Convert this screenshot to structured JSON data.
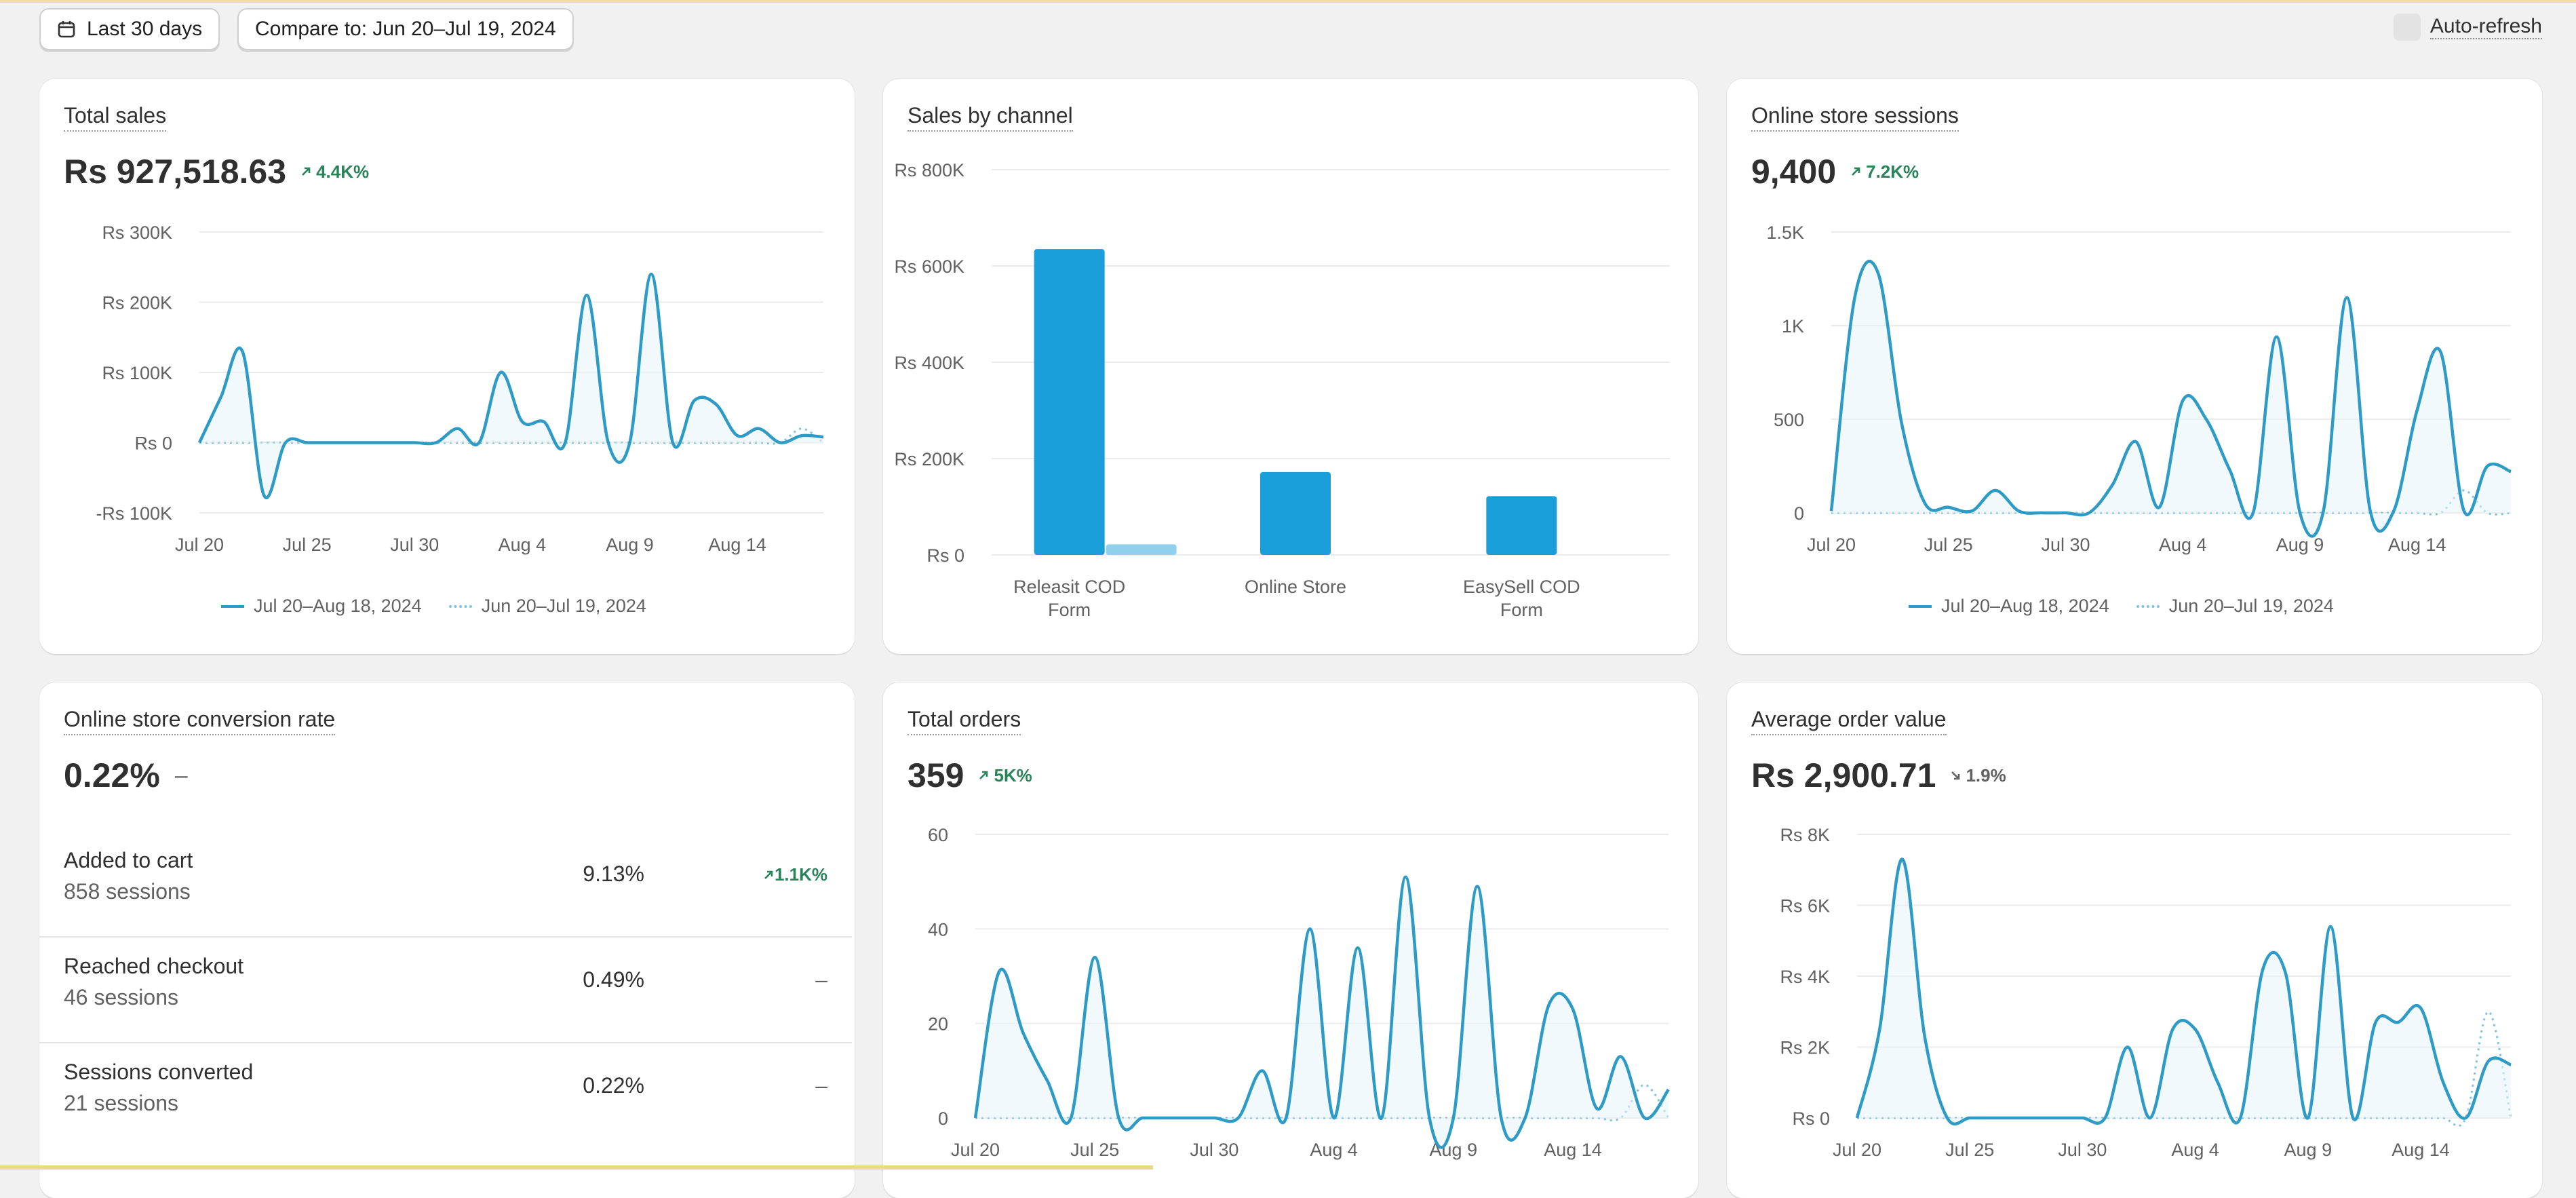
{
  "toolbar": {
    "date_range_label": "Last 30 days",
    "compare_label": "Compare to: Jun 20–Jul 19, 2024",
    "auto_refresh_label": "Auto-refresh"
  },
  "legend": {
    "current": "Jul 20–Aug 18, 2024",
    "previous": "Jun 20–Jul 19, 2024"
  },
  "colors": {
    "line": "#2e9bc6",
    "bar": "#1a9ed9",
    "bar_light": "#8fd0ec",
    "positive": "#29845a"
  },
  "cards": {
    "total_sales": {
      "title": "Total sales",
      "value": "Rs 927,518.63",
      "delta": "4.4K%"
    },
    "sales_by_channel": {
      "title": "Sales by channel"
    },
    "sessions": {
      "title": "Online store sessions",
      "value": "9,400",
      "delta": "7.2K%"
    },
    "conversion": {
      "title": "Online store conversion rate",
      "value": "0.22%",
      "dash": "–",
      "rows": [
        {
          "name": "Added to cart",
          "sessions": "858 sessions",
          "pct": "9.13%",
          "delta": "1.1K%"
        },
        {
          "name": "Reached checkout",
          "sessions": "46 sessions",
          "pct": "0.49%",
          "delta": "–"
        },
        {
          "name": "Sessions converted",
          "sessions": "21 sessions",
          "pct": "0.22%",
          "delta": "–"
        }
      ]
    },
    "total_orders": {
      "title": "Total orders",
      "value": "359",
      "delta": "5K%"
    },
    "aov": {
      "title": "Average order value",
      "value": "Rs 2,900.71",
      "delta": "1.9%"
    }
  },
  "chart_data": [
    {
      "type": "line",
      "name": "total_sales",
      "x_ticks": [
        "Jul 20",
        "Jul 25",
        "Jul 30",
        "Aug 4",
        "Aug 9",
        "Aug 14"
      ],
      "y_ticks": [
        "Rs 300K",
        "Rs 200K",
        "Rs 100K",
        "Rs 0",
        "-Rs 100K"
      ],
      "ylim": [
        -100000,
        300000
      ],
      "series": [
        {
          "name": "Jul 20–Aug 18, 2024",
          "x": [
            0,
            1,
            2,
            3,
            4,
            5,
            6,
            7,
            8,
            9,
            10,
            11,
            12,
            13,
            14,
            15,
            16,
            17,
            18,
            19,
            20,
            21,
            22,
            23,
            24,
            25,
            26,
            27,
            28,
            29
          ],
          "values": [
            0,
            65000,
            130000,
            -75000,
            0,
            0,
            0,
            0,
            0,
            0,
            0,
            0,
            20000,
            0,
            100000,
            30000,
            30000,
            0,
            210000,
            0,
            0,
            240000,
            0,
            60000,
            55000,
            10000,
            20000,
            0,
            10000,
            8000
          ]
        },
        {
          "name": "Jun 20–Jul 19, 2024",
          "x": [
            0,
            1,
            2,
            3,
            4,
            5,
            6,
            7,
            8,
            9,
            10,
            11,
            12,
            13,
            14,
            15,
            16,
            17,
            18,
            19,
            20,
            21,
            22,
            23,
            24,
            25,
            26,
            27,
            28,
            29
          ],
          "values": [
            0,
            0,
            0,
            0,
            0,
            0,
            0,
            0,
            0,
            0,
            0,
            0,
            0,
            0,
            0,
            0,
            0,
            0,
            0,
            0,
            0,
            0,
            0,
            0,
            0,
            0,
            0,
            0,
            20000,
            0
          ]
        }
      ]
    },
    {
      "type": "bar",
      "name": "sales_by_channel",
      "categories": [
        "Releasit COD Form",
        "Online Store",
        "EasySell COD Form"
      ],
      "y_ticks": [
        "Rs 800K",
        "Rs 600K",
        "Rs 400K",
        "Rs 200K",
        "Rs 0"
      ],
      "ylim": [
        0,
        800000
      ],
      "series": [
        {
          "name": "Jul 20–Aug 18, 2024",
          "values": [
            635000,
            172000,
            122000
          ]
        },
        {
          "name": "Jun 20–Jul 19, 2024",
          "values": [
            22000,
            0,
            0
          ]
        }
      ]
    },
    {
      "type": "line",
      "name": "online_store_sessions",
      "x_ticks": [
        "Jul 20",
        "Jul 25",
        "Jul 30",
        "Aug 4",
        "Aug 9",
        "Aug 14"
      ],
      "y_ticks": [
        "1.5K",
        "1K",
        "500",
        "0"
      ],
      "ylim": [
        0,
        1500
      ],
      "series": [
        {
          "name": "Jul 20–Aug 18, 2024",
          "x": [
            0,
            1,
            2,
            3,
            4,
            5,
            6,
            7,
            8,
            9,
            10,
            11,
            12,
            13,
            14,
            15,
            16,
            17,
            18,
            19,
            20,
            21,
            22,
            23,
            24,
            25,
            26,
            27,
            28,
            29
          ],
          "values": [
            10,
            1150,
            1280,
            480,
            50,
            30,
            10,
            120,
            10,
            0,
            0,
            0,
            150,
            380,
            30,
            600,
            500,
            230,
            0,
            940,
            0,
            10,
            1150,
            10,
            10,
            550,
            860,
            10,
            250,
            220
          ]
        },
        {
          "name": "Jun 20–Jul 19, 2024",
          "x": [
            0,
            1,
            2,
            3,
            4,
            5,
            6,
            7,
            8,
            9,
            10,
            11,
            12,
            13,
            14,
            15,
            16,
            17,
            18,
            19,
            20,
            21,
            22,
            23,
            24,
            25,
            26,
            27,
            28,
            29
          ],
          "values": [
            0,
            0,
            0,
            0,
            0,
            0,
            0,
            0,
            0,
            0,
            0,
            0,
            0,
            0,
            0,
            0,
            0,
            0,
            0,
            0,
            0,
            0,
            0,
            0,
            0,
            0,
            0,
            120,
            0,
            0
          ]
        }
      ]
    },
    {
      "type": "line",
      "name": "total_orders",
      "x_ticks": [
        "Jul 20",
        "Jul 25",
        "Jul 30",
        "Aug 4",
        "Aug 9",
        "Aug 14"
      ],
      "y_ticks": [
        "60",
        "40",
        "20",
        "0"
      ],
      "ylim": [
        0,
        60
      ],
      "series": [
        {
          "name": "Jul 20–Aug 18, 2024",
          "x": [
            0,
            1,
            2,
            3,
            4,
            5,
            6,
            7,
            8,
            9,
            10,
            11,
            12,
            13,
            14,
            15,
            16,
            17,
            18,
            19,
            20,
            21,
            22,
            23,
            24,
            25,
            26,
            27,
            28,
            29
          ],
          "values": [
            0,
            31,
            18,
            8,
            0,
            34,
            0,
            0,
            0,
            0,
            0,
            0,
            10,
            0,
            40,
            0,
            36,
            0,
            51,
            0,
            0,
            49,
            0,
            0,
            24,
            23,
            2,
            13,
            0,
            6
          ]
        },
        {
          "name": "Jun 20–Jul 19, 2024",
          "x": [
            0,
            1,
            2,
            3,
            4,
            5,
            6,
            7,
            8,
            9,
            10,
            11,
            12,
            13,
            14,
            15,
            16,
            17,
            18,
            19,
            20,
            21,
            22,
            23,
            24,
            25,
            26,
            27,
            28,
            29
          ],
          "values": [
            0,
            0,
            0,
            0,
            0,
            0,
            0,
            0,
            0,
            0,
            0,
            0,
            0,
            0,
            0,
            0,
            0,
            0,
            0,
            0,
            0,
            0,
            0,
            0,
            0,
            0,
            0,
            0,
            7,
            0
          ]
        }
      ]
    },
    {
      "type": "line",
      "name": "average_order_value",
      "x_ticks": [
        "Jul 20",
        "Jul 25",
        "Jul 30",
        "Aug 4",
        "Aug 9",
        "Aug 14"
      ],
      "y_ticks": [
        "Rs 8K",
        "Rs 6K",
        "Rs 4K",
        "Rs 2K",
        "Rs 0"
      ],
      "ylim": [
        0,
        8000
      ],
      "series": [
        {
          "name": "Jul 20–Aug 18, 2024",
          "x": [
            0,
            1,
            2,
            3,
            4,
            5,
            6,
            7,
            8,
            9,
            10,
            11,
            12,
            13,
            14,
            15,
            16,
            17,
            18,
            19,
            20,
            21,
            22,
            23,
            24,
            25,
            26,
            27,
            28,
            29
          ],
          "values": [
            0,
            2500,
            7300,
            2300,
            0,
            0,
            0,
            0,
            0,
            0,
            0,
            0,
            2000,
            0,
            2500,
            2500,
            1000,
            0,
            4200,
            4100,
            0,
            5400,
            0,
            2700,
            2700,
            3100,
            1000,
            0,
            1600,
            1500
          ]
        },
        {
          "name": "Jun 20–Jul 19, 2024",
          "x": [
            0,
            1,
            2,
            3,
            4,
            5,
            6,
            7,
            8,
            9,
            10,
            11,
            12,
            13,
            14,
            15,
            16,
            17,
            18,
            19,
            20,
            21,
            22,
            23,
            24,
            25,
            26,
            27,
            28,
            29
          ],
          "values": [
            0,
            0,
            0,
            0,
            0,
            0,
            0,
            0,
            0,
            0,
            0,
            0,
            0,
            0,
            0,
            0,
            0,
            0,
            0,
            0,
            0,
            0,
            0,
            0,
            0,
            0,
            0,
            0,
            3000,
            0
          ]
        }
      ]
    }
  ]
}
